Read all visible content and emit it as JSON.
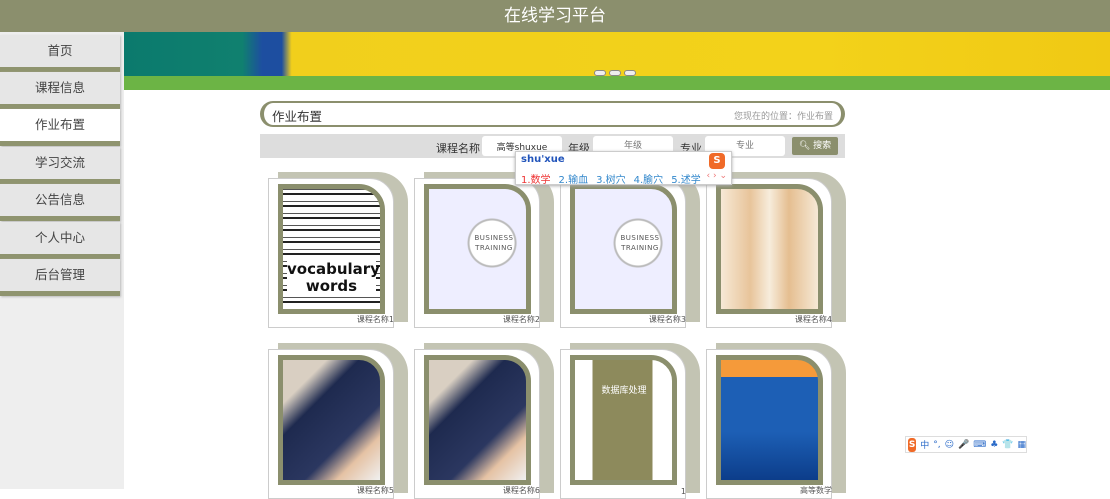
{
  "header": {
    "title": "在线学习平台"
  },
  "sidebar": {
    "items": [
      {
        "label": "首页"
      },
      {
        "label": "课程信息"
      },
      {
        "label": "作业布置",
        "active": true
      },
      {
        "label": "学习交流"
      },
      {
        "label": "公告信息"
      },
      {
        "label": "个人中心"
      },
      {
        "label": "后台管理"
      }
    ]
  },
  "page": {
    "title": "作业布置",
    "location": "您现在的位置：作业布置"
  },
  "search": {
    "course_label": "课程名称",
    "course_value": "高等shuxue",
    "grade_label": "年级",
    "grade_placeholder": "年级",
    "major_label": "专业",
    "major_placeholder": "专业",
    "button": "搜索"
  },
  "ime": {
    "pinyin": "shu'xue",
    "candidates": [
      "1.数学",
      "2.输血",
      "3.树穴",
      "4.腧穴",
      "5.述学"
    ],
    "logo": "S",
    "toolbar": [
      "中",
      "°,",
      "☺",
      "🎤",
      "⌨",
      "♣",
      "👕",
      "▦"
    ]
  },
  "courses": [
    {
      "name": "课程名称1",
      "image": "vocabulary words"
    },
    {
      "name": "课程名称2",
      "image": "business training"
    },
    {
      "name": "课程名称3",
      "image": "business training"
    },
    {
      "name": "课程名称4",
      "image": "yoga"
    },
    {
      "name": "课程名称5",
      "image": "english study"
    },
    {
      "name": "课程名称6",
      "image": "english study"
    },
    {
      "name": "1",
      "image": "数据库处理"
    },
    {
      "name": "高等数学",
      "image": "高等数学"
    }
  ],
  "colors": {
    "accent": "#8b8f6d",
    "ime": "#f06a28"
  }
}
